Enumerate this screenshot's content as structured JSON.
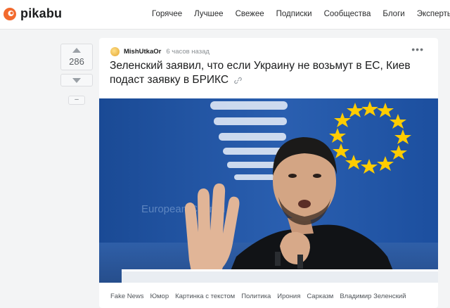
{
  "header": {
    "logo_text": "pikabu",
    "nav": [
      "Горячее",
      "Лучшее",
      "Свежее",
      "Подписки",
      "Сообщества",
      "Блоги",
      "Эксперты"
    ]
  },
  "vote": {
    "rating": "286",
    "collapse_label": "–"
  },
  "post": {
    "author": "MishUtkaOr",
    "time": "6 часов назад",
    "title": "Зеленский заявил, что если Украину не возьмут в ЕС, Киев подаст заявку в БРИКС",
    "more_label": "•••",
    "image_text": "European Council",
    "tags": [
      "Fake News",
      "Юмор",
      "Картинка с текстом",
      "Политика",
      "Ирония",
      "Сарказм",
      "Владимир Зеленский"
    ]
  },
  "colors": {
    "brand": "#f26a2e",
    "eu_blue": "#1e4f9e",
    "eu_star": "#ffcc00"
  }
}
